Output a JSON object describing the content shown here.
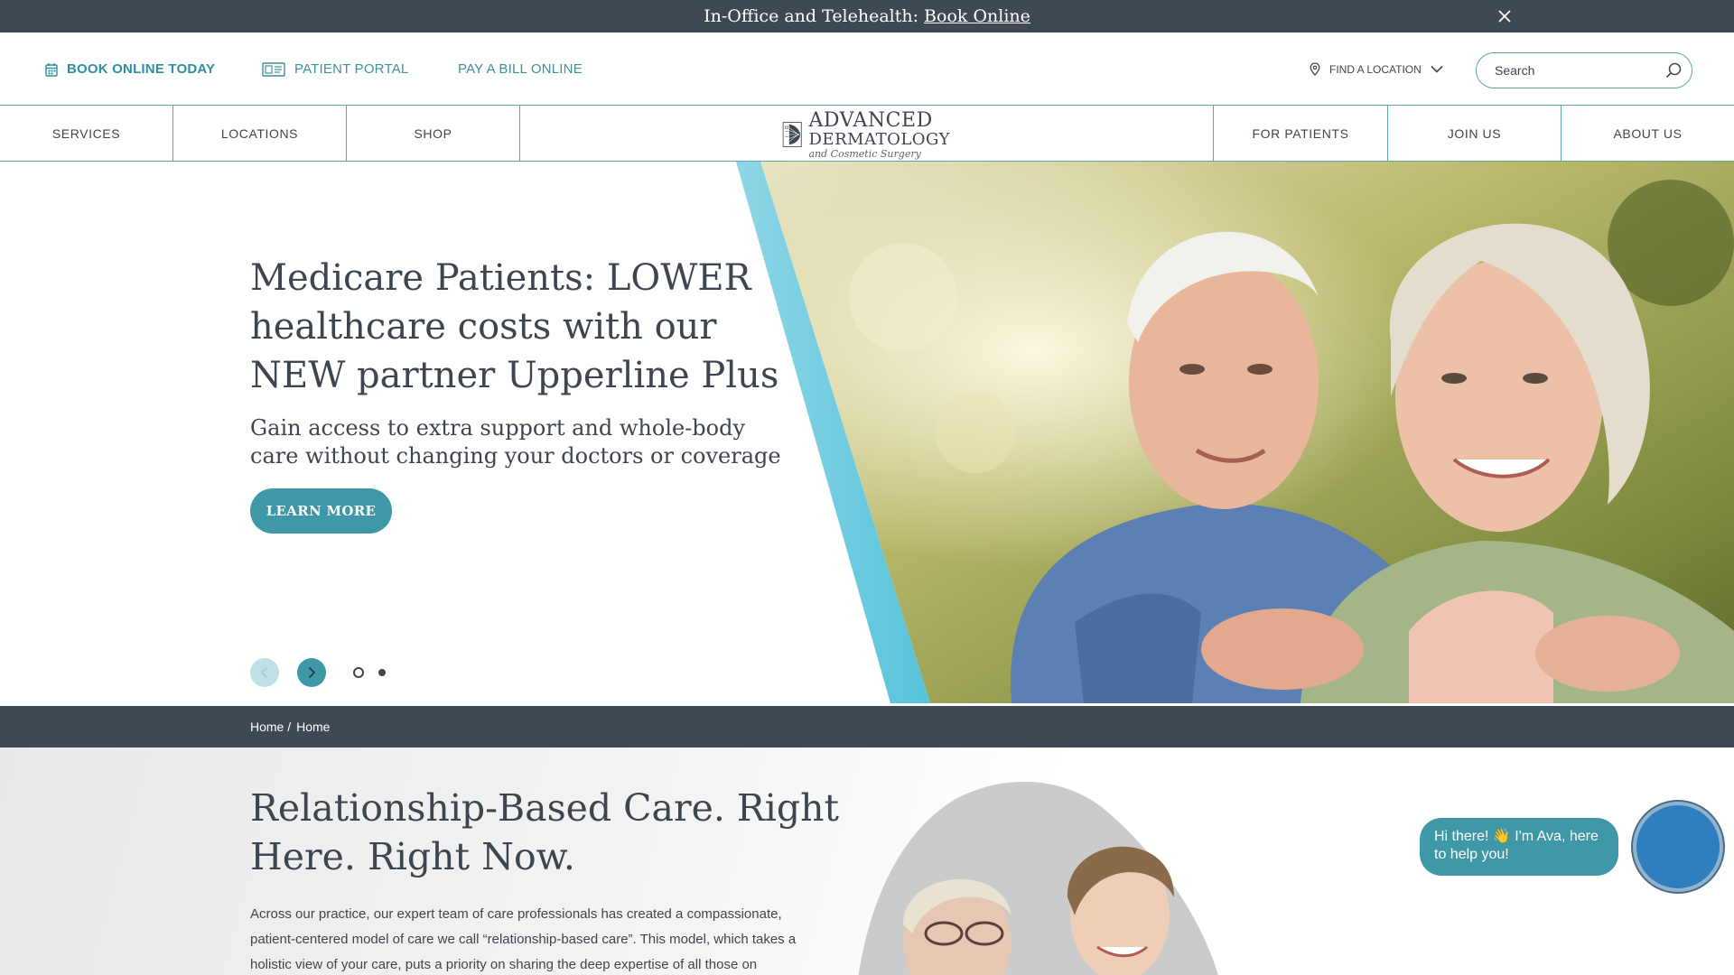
{
  "announcement": {
    "text": "In-Office and Telehealth:",
    "link": "Book Online"
  },
  "utility": {
    "book_online": "BOOK ONLINE TODAY",
    "patient_portal": "PATIENT PORTAL",
    "pay_bill": "PAY A BILL ONLINE",
    "find_location": "FIND A LOCATION",
    "search_placeholder": "Search"
  },
  "nav": {
    "left": [
      "SERVICES",
      "LOCATIONS",
      "SHOP"
    ],
    "right": [
      "FOR PATIENTS",
      "JOIN US",
      "ABOUT US"
    ]
  },
  "logo": {
    "line1": "ADVANCED",
    "line2": "DERMATOLOGY",
    "line3": "and Cosmetic Surgery"
  },
  "hero": {
    "title": "Medicare Patients: LOWER healthcare costs with our NEW partner Upperline Plus",
    "subtitle": "Gain access to extra support and whole-body care without changing your doctors or coverage",
    "cta": "LEARN MORE",
    "slides_total": 2,
    "active_slide": 1
  },
  "breadcrumb": [
    "Home /",
    "Home"
  ],
  "intro": {
    "title": "Relationship-Based Care. Right Here. Right Now.",
    "body": "Across our practice, our expert team of care professionals has created a compassionate, patient-centered model of care we call “relationship-based care”. This model, which takes a holistic view of your care, puts a priority on sharing the deep expertise of all those on"
  },
  "chat": {
    "greeting": "Hi there! 👋 I'm Ava, here to help you!"
  },
  "colors": {
    "accent": "#3f98a8",
    "dark_bar": "#3f4953",
    "text": "#3d4650"
  }
}
